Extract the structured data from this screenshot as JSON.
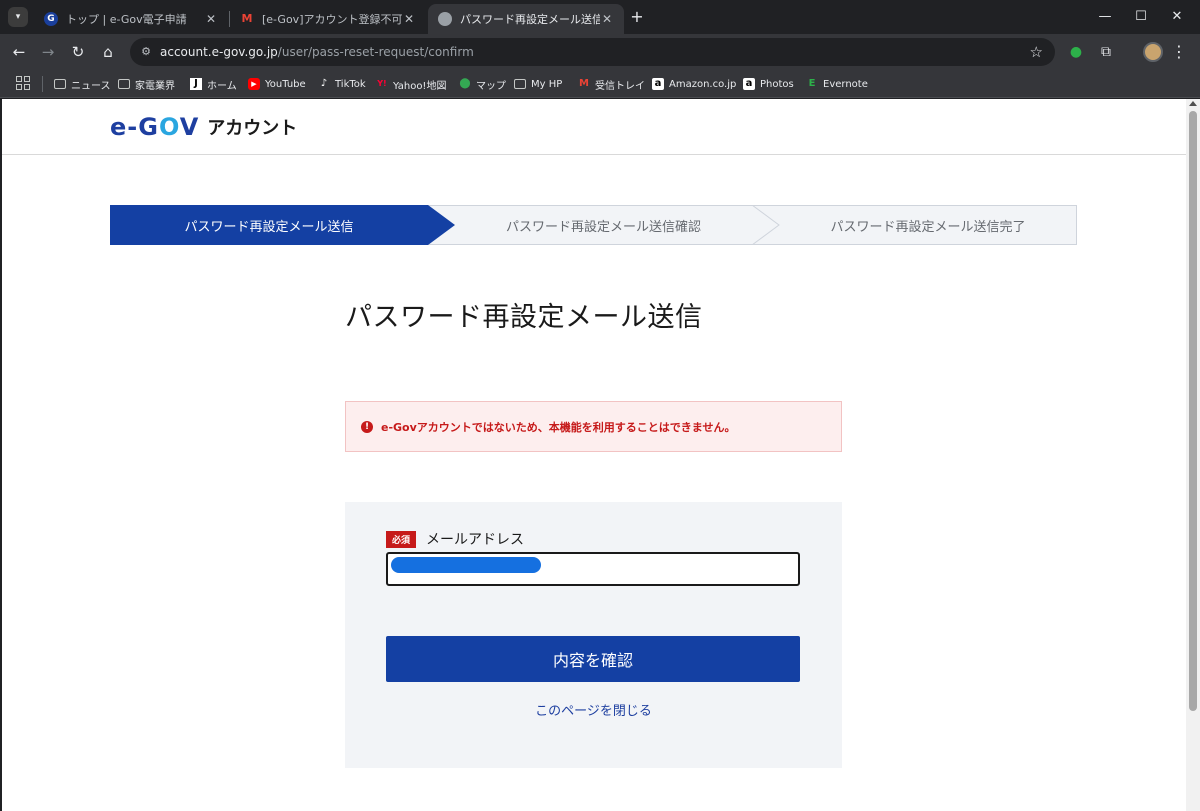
{
  "browser": {
    "tabs": [
      {
        "title": "トップ | e-Gov電子申請",
        "favicon": "G",
        "active": false
      },
      {
        "title": "[e-Gov]アカウント登録不可-メール",
        "favicon": "M",
        "active": false
      },
      {
        "title": "パスワード再設定メール送信",
        "favicon": "",
        "active": true
      }
    ],
    "tab_close_glyph": "✕",
    "new_tab_glyph": "+",
    "window_controls": {
      "minimize": "—",
      "maximize": "☐",
      "close": "✕"
    },
    "url": {
      "host": "account.e-gov.go.jp",
      "path": "/user/pass-reset-request/confirm"
    },
    "nav_icons": {
      "back": "←",
      "forward": "→",
      "reload": "↻",
      "home": "⌂",
      "star": "☆",
      "menu": "⋮"
    },
    "bookmarks": [
      {
        "label": "ニュース",
        "icon": "folder-icon"
      },
      {
        "label": "家電業界",
        "icon": "folder-icon"
      },
      {
        "label": "ホーム",
        "icon": "J"
      },
      {
        "label": "YouTube",
        "icon": "▶"
      },
      {
        "label": "TikTok",
        "icon": "♪"
      },
      {
        "label": "Yahoo!地図",
        "icon": "Y!"
      },
      {
        "label": "マップ",
        "icon": "⬤"
      },
      {
        "label": "My HP",
        "icon": "folder-icon"
      },
      {
        "label": "受信トレイ",
        "icon": "M"
      },
      {
        "label": "Amazon.co.jp",
        "icon": "a"
      },
      {
        "label": "Photos",
        "icon": "a"
      },
      {
        "label": "Evernote",
        "icon": "E"
      }
    ]
  },
  "page": {
    "logo": {
      "mark_e": "e-",
      "mark_g": "G",
      "mark_o": "O",
      "mark_v": "V",
      "sub": "アカウント"
    },
    "steps": [
      {
        "label": "パスワード再設定メール送信",
        "state": "current"
      },
      {
        "label": "パスワード再設定メール送信確認",
        "state": "upcoming"
      },
      {
        "label": "パスワード再設定メール送信完了",
        "state": "upcoming"
      }
    ],
    "title": "パスワード再設定メール送信",
    "alert": {
      "icon": "!",
      "message": "e-Govアカウントではないため、本機能を利用することはできません。"
    },
    "form": {
      "required_badge": "必須",
      "email_label": "メールアドレス",
      "email_value": "",
      "submit_label": "内容を確認",
      "close_link": "このページを閉じる"
    }
  },
  "colors": {
    "brand_blue": "#1440a3",
    "accent_cyan": "#2aa6e0",
    "error_red": "#c61a1a",
    "panel_bg": "#f2f4f7"
  }
}
